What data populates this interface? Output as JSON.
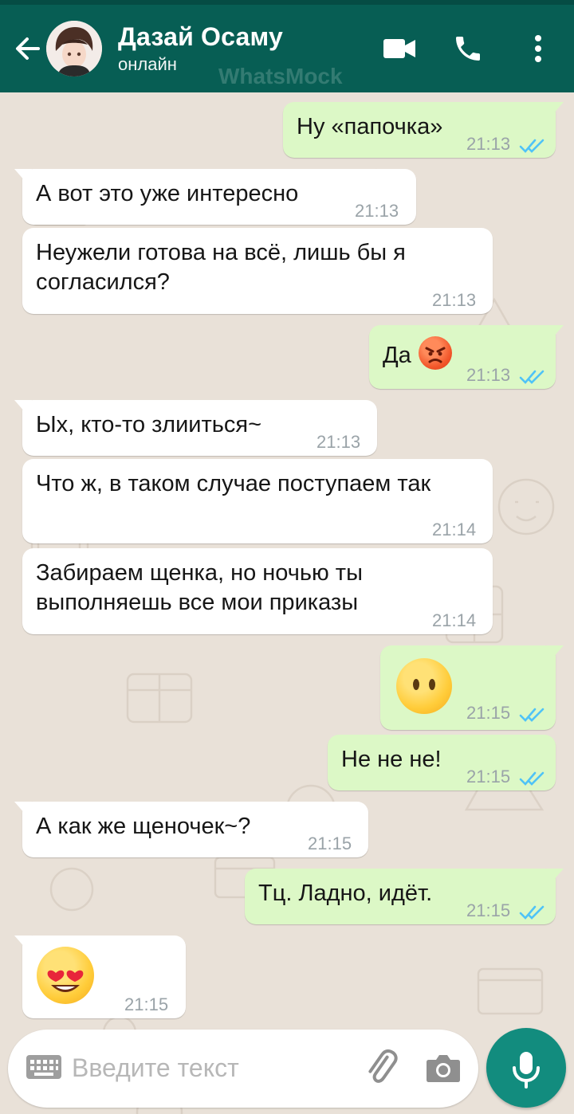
{
  "header": {
    "contact_name": "Дазай Осаму",
    "status": "онлайн",
    "watermark": "WhatsMock",
    "background_color": "#075e54",
    "icons": [
      "back-arrow-icon",
      "video-call-icon",
      "phone-icon",
      "more-vertical-icon"
    ]
  },
  "messages": [
    {
      "direction": "out",
      "text": "Ну «папочка»",
      "time": "21:13",
      "status": "read"
    },
    {
      "direction": "in",
      "text": "А вот это уже интересно",
      "time": "21:13"
    },
    {
      "direction": "in",
      "text": "Неужели готова на всё, лишь бы я\nсогласился?",
      "time": "21:13"
    },
    {
      "direction": "out",
      "text": "Да",
      "emoji": "angry-face",
      "time": "21:13",
      "status": "read"
    },
    {
      "direction": "in",
      "text": "Ых, кто-то злииться~",
      "time": "21:13"
    },
    {
      "direction": "in",
      "text": "Что ж, в таком случае поступаем так",
      "time": "21:14"
    },
    {
      "direction": "in",
      "text": "Забираем щенка, но ночью ты\nвыполняешь все мои приказы",
      "time": "21:14"
    },
    {
      "direction": "out",
      "emoji": "face-without-mouth",
      "time": "21:15",
      "status": "read"
    },
    {
      "direction": "out",
      "text": "Не не не!",
      "time": "21:15",
      "status": "read"
    },
    {
      "direction": "in",
      "text": "А как же щеночек~?",
      "time": "21:15"
    },
    {
      "direction": "out",
      "text": "Тц. Ладно, идёт.",
      "time": "21:15",
      "status": "read"
    },
    {
      "direction": "in",
      "emoji": "heart-eyes-face",
      "time": "21:15"
    }
  ],
  "input": {
    "placeholder": "Введите текст",
    "icons": [
      "keyboard-icon",
      "attach-icon",
      "camera-icon"
    ]
  },
  "colors": {
    "incoming_bubble": "#ffffff",
    "outgoing_bubble": "#dcf8c6",
    "chat_background": "#e9e1d8",
    "read_ticks": "#4fc3f7",
    "fab": "#128c7e"
  }
}
